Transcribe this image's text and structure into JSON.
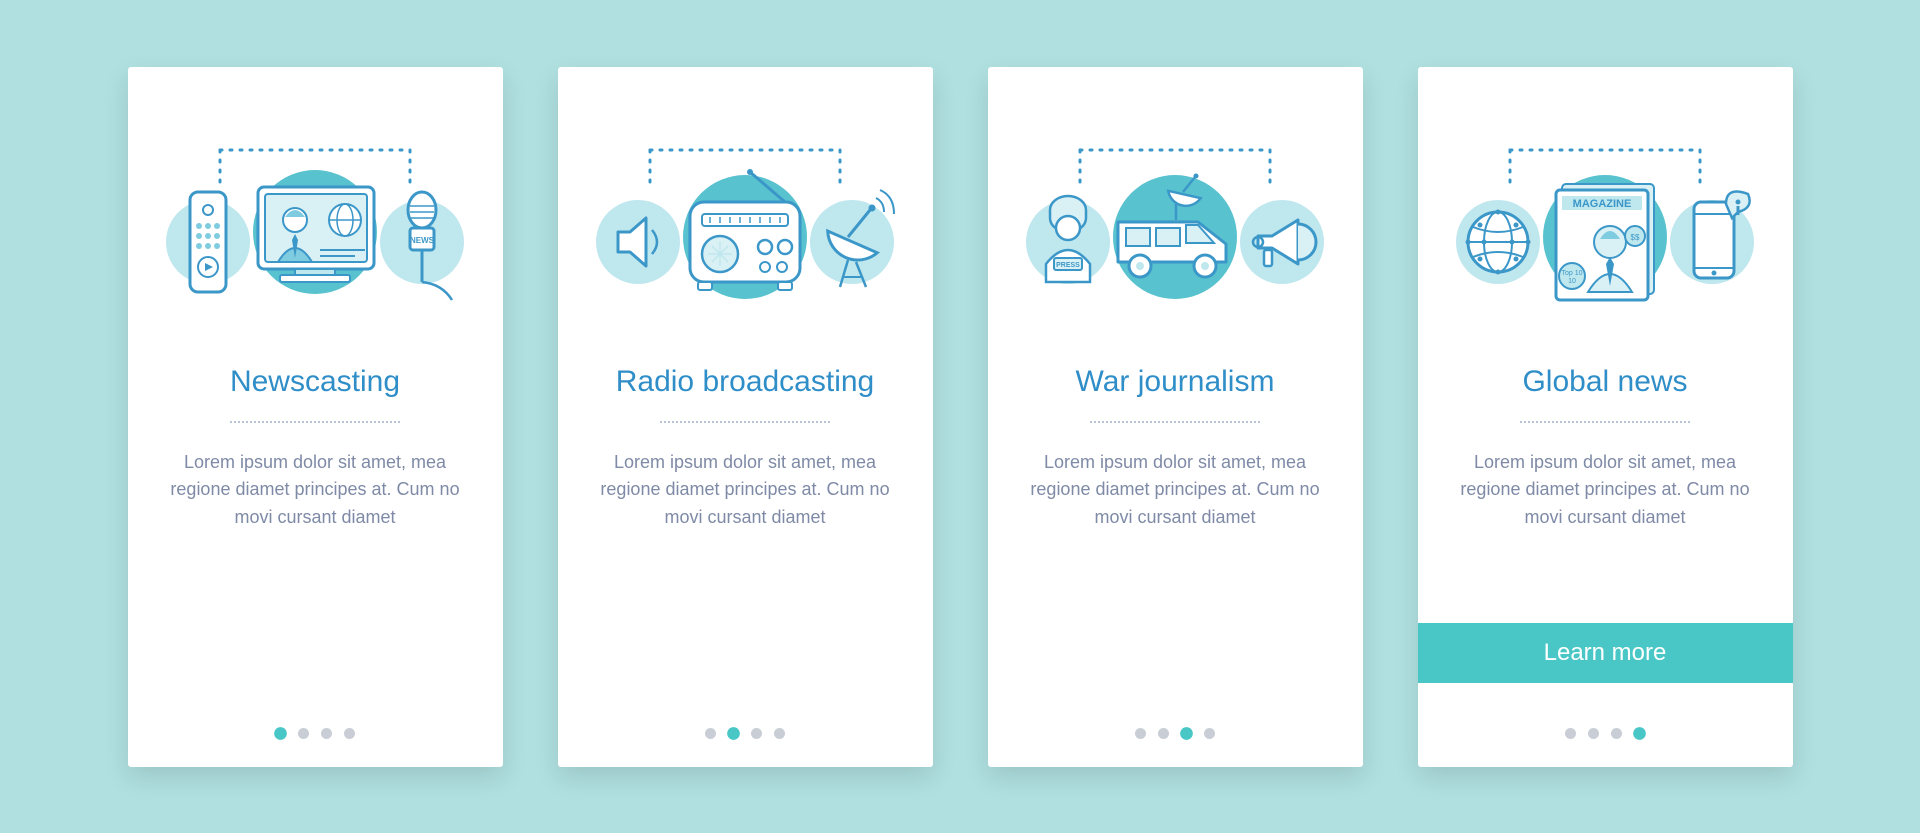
{
  "colors": {
    "background": "#b0e0e0",
    "accent": "#49c6c6",
    "title": "#2f8ec8",
    "text": "#7e8aa6",
    "dot_inactive": "#c9ced6"
  },
  "cta_label": "Learn more",
  "body_text": "Lorem ipsum dolor sit amet, mea regione diamet principes at. Cum no movi cursant diamet",
  "cards": [
    {
      "title": "Newscasting",
      "center_icon": "tv-anchor-icon",
      "left_icon": "remote-icon",
      "right_icon": "news-mic-icon",
      "right_label": "NEWS",
      "active_index": 0
    },
    {
      "title": "Radio broadcasting",
      "center_icon": "radio-icon",
      "left_icon": "speaker-icon",
      "right_icon": "satellite-dish-icon",
      "active_index": 1
    },
    {
      "title": "War journalism",
      "center_icon": "news-van-icon",
      "left_icon": "press-reporter-icon",
      "left_label": "PRESS",
      "right_icon": "megaphone-icon",
      "active_index": 2
    },
    {
      "title": "Global news",
      "center_icon": "magazine-icon",
      "center_label": "MAGAZINE",
      "center_sublabel": "Top 10",
      "left_icon": "globe-icon",
      "right_icon": "phone-info-icon",
      "active_index": 3
    }
  ]
}
